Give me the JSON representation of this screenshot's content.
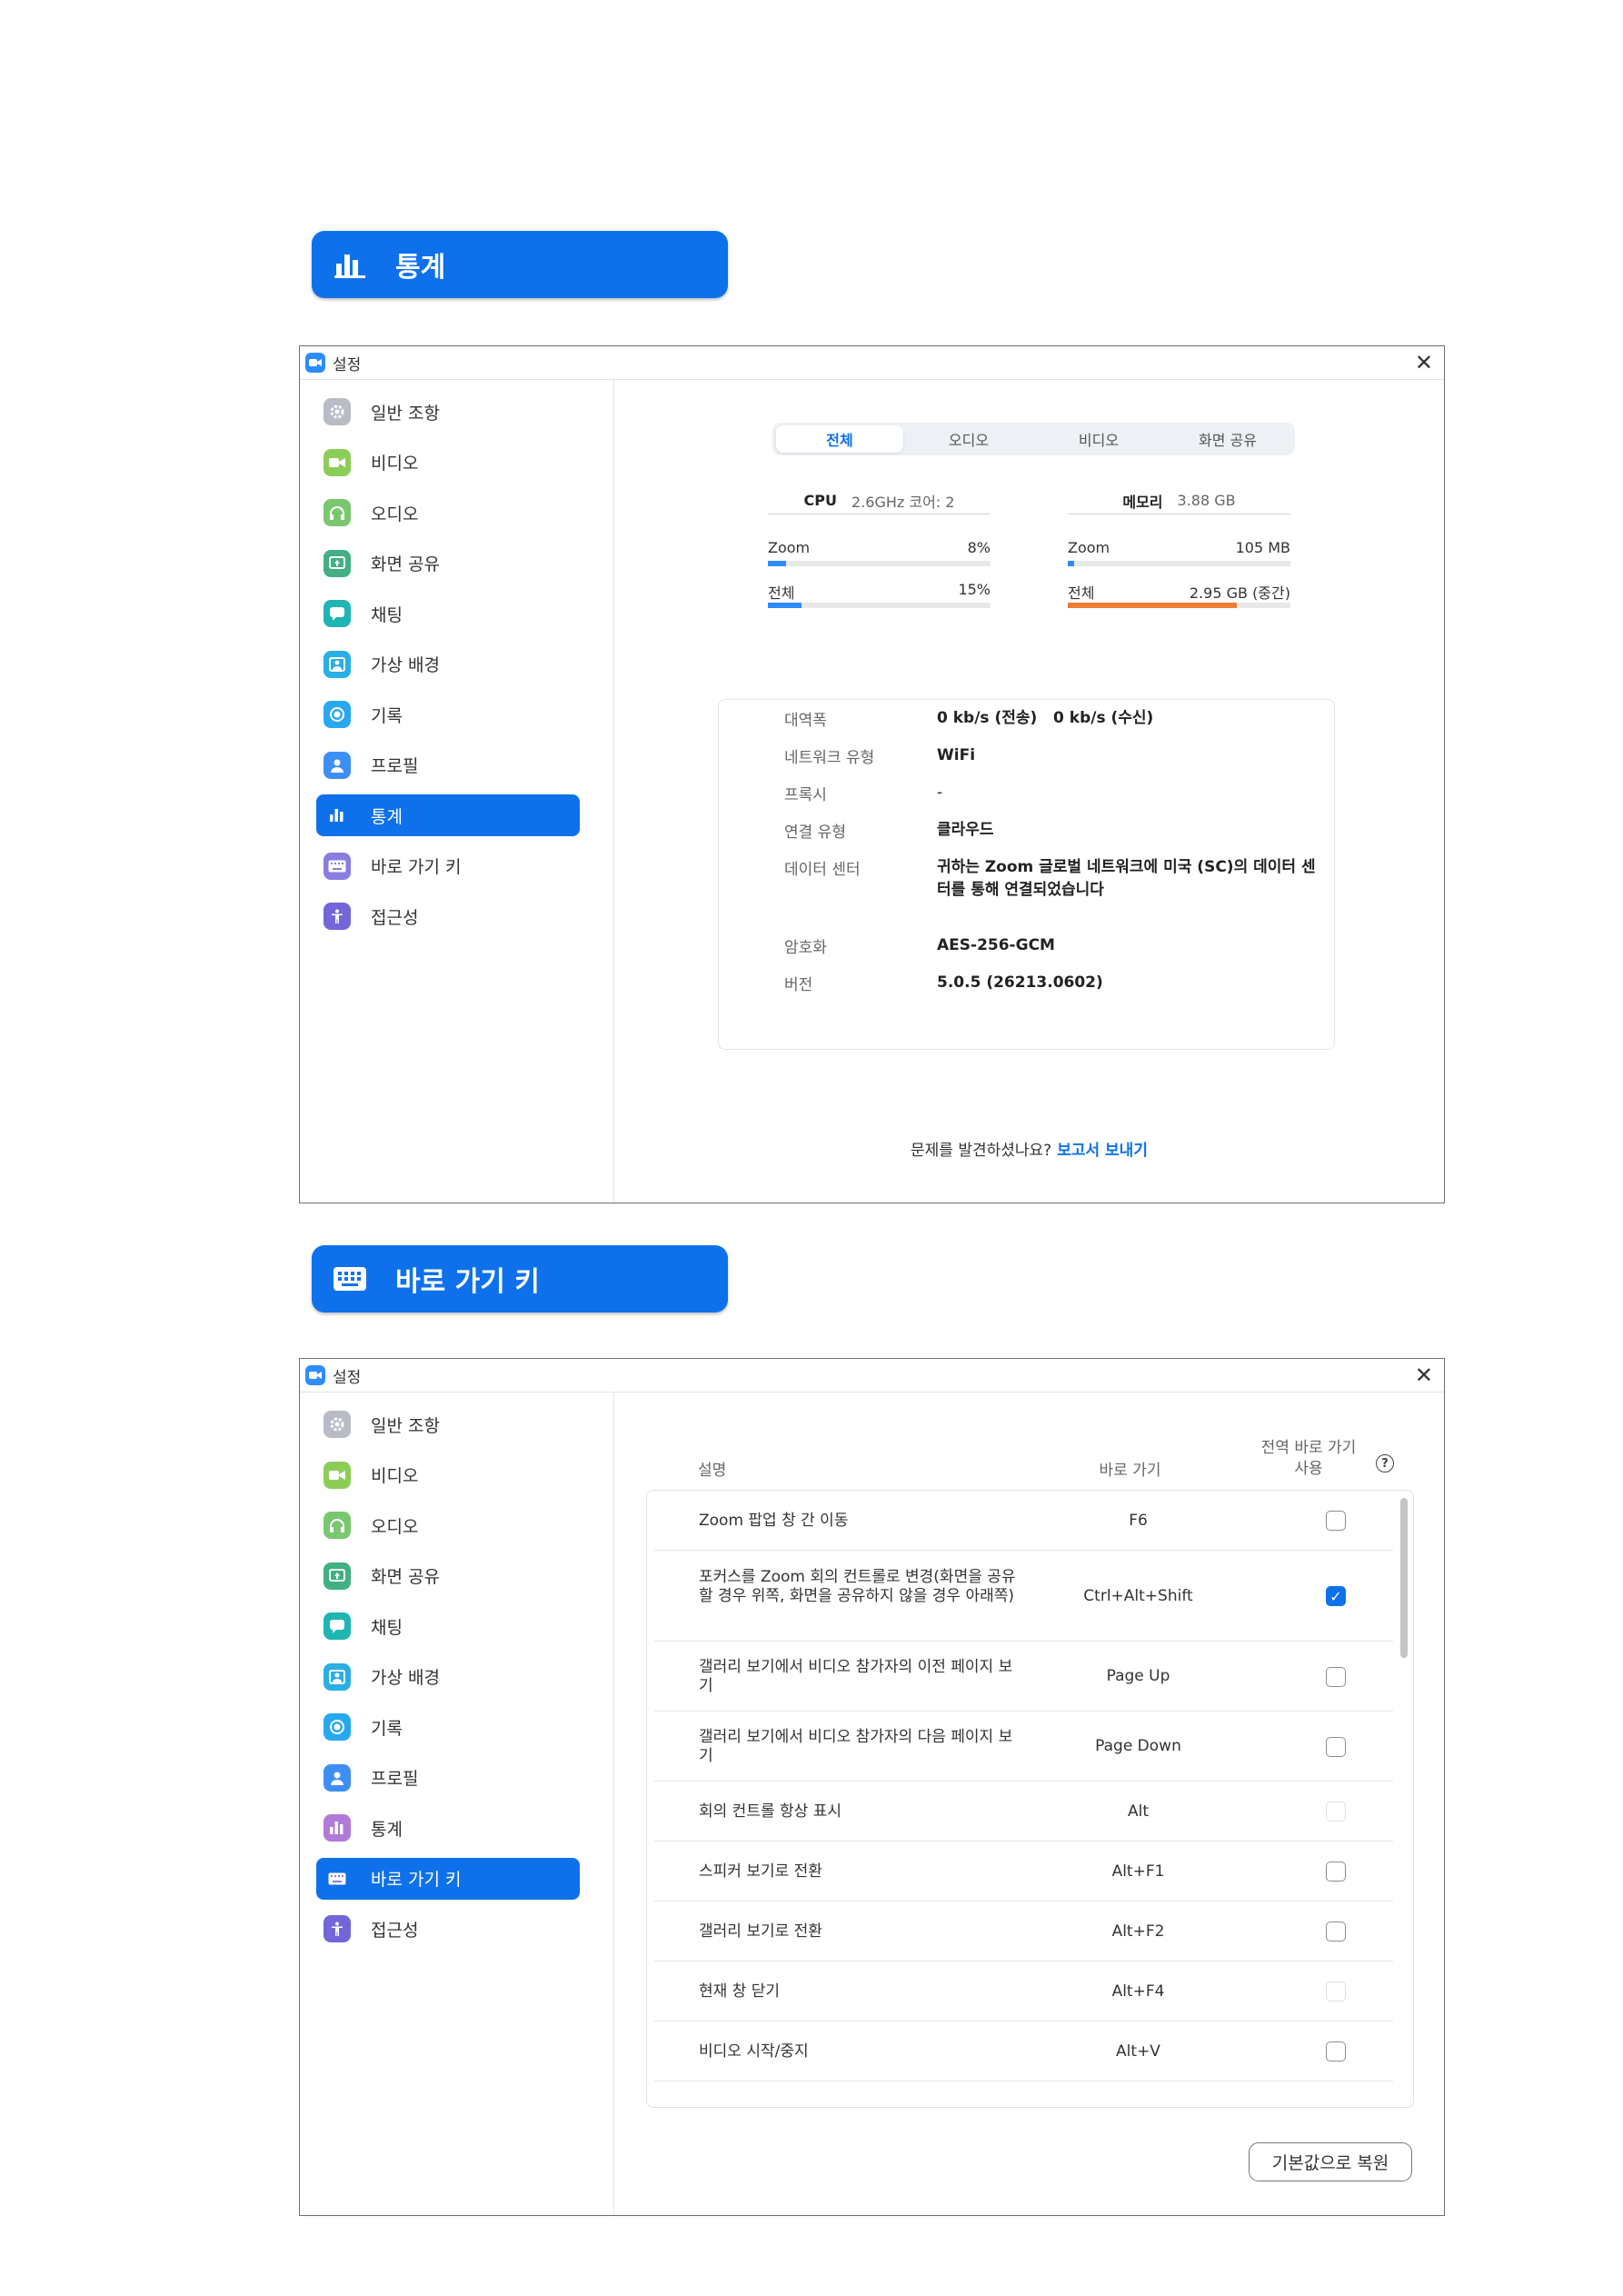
{
  "banner_stats": {
    "title": "통계",
    "icon": "bar-chart-icon"
  },
  "banner_shortcuts": {
    "title": "바로 가기 키",
    "icon": "keyboard-icon"
  },
  "window": {
    "title": "설정",
    "close": "✕"
  },
  "sidebar": {
    "items": [
      {
        "label": "일반 조항",
        "icon": "gear-icon",
        "color": "#b9bcc4"
      },
      {
        "label": "비디오",
        "icon": "video-camera-icon",
        "color": "#8ccd57"
      },
      {
        "label": "오디오",
        "icon": "headphones-icon",
        "color": "#79c86f"
      },
      {
        "label": "화면 공유",
        "icon": "share-screen-icon",
        "color": "#41b083"
      },
      {
        "label": "채팅",
        "icon": "chat-bubble-icon",
        "color": "#1fb5b2"
      },
      {
        "label": "가상 배경",
        "icon": "person-background-icon",
        "color": "#2aaee6"
      },
      {
        "label": "기록",
        "icon": "record-icon",
        "color": "#28a8f0"
      },
      {
        "label": "프로필",
        "icon": "profile-icon",
        "color": "#3d8ff5"
      },
      {
        "label": "통계",
        "icon": "bar-chart-icon",
        "color": "#b27ad8"
      },
      {
        "label": "바로 가기 키",
        "icon": "keyboard-icon",
        "color": "#8a7de0"
      },
      {
        "label": "접근성",
        "icon": "accessibility-icon",
        "color": "#7366d9"
      }
    ]
  },
  "stats": {
    "tabs": [
      "전체",
      "오디오",
      "비디오",
      "화면 공유"
    ],
    "cpu": {
      "label": "CPU",
      "detail": "2.6GHz 코어: 2",
      "rows": [
        {
          "name": "Zoom",
          "value": "8%",
          "fill": 0.08,
          "color": "#2d8cff"
        },
        {
          "name": "전체",
          "value": "15%",
          "fill": 0.15,
          "color": "#2d8cff"
        }
      ]
    },
    "memory": {
      "label": "메모리",
      "detail": "3.88 GB",
      "rows": [
        {
          "name": "Zoom",
          "value": "105 MB",
          "fill": 0.03,
          "color": "#2d8cff"
        },
        {
          "name": "전체",
          "value": "2.95 GB (중간)",
          "fill": 0.76,
          "color": "#ed7d31"
        }
      ]
    },
    "info": [
      {
        "label": "대역폭",
        "value": "0 kb/s (전송)   0 kb/s (수신)"
      },
      {
        "label": "네트워크 유형",
        "value": "WiFi"
      },
      {
        "label": "프록시",
        "value": "-"
      },
      {
        "label": "연결 유형",
        "value": "클라우드"
      },
      {
        "label": "데이터 센터",
        "value": "귀하는 Zoom 글로벌 네트워크에 미국 (SC)의 데이터 센터를 통해 연결되었습니다"
      },
      {
        "label": "암호화",
        "value": "AES-256-GCM"
      },
      {
        "label": "버전",
        "value": "5.0.5 (26213.0602)"
      }
    ],
    "footer_text": "문제를 발견하셨나요?",
    "footer_link": "보고서 보내기"
  },
  "shortcuts": {
    "col_desc": "설명",
    "col_key": "바로 가기",
    "col_global_1": "전역 바로 가기",
    "col_global_2": "사용",
    "help": "?",
    "rows": [
      {
        "desc": "Zoom 팝업 창 간 이동",
        "key": "F6",
        "state": "unchecked"
      },
      {
        "desc": "포커스를 Zoom 회의 컨트롤로 변경(화면을 공유할 경우 위쪽, 화면을 공유하지 않을 경우 아래쪽)",
        "key": "Ctrl+Alt+Shift",
        "state": "checked"
      },
      {
        "desc": "갤러리 보기에서 비디오 참가자의 이전 페이지 보기",
        "key": "Page Up",
        "state": "unchecked"
      },
      {
        "desc": "갤러리 보기에서 비디오 참가자의 다음 페이지 보기",
        "key": "Page Down",
        "state": "unchecked"
      },
      {
        "desc": "회의 컨트롤 항상 표시",
        "key": "Alt",
        "state": "disabled"
      },
      {
        "desc": "스피커 보기로 전환",
        "key": "Alt+F1",
        "state": "unchecked"
      },
      {
        "desc": "갤러리 보기로 전환",
        "key": "Alt+F2",
        "state": "unchecked"
      },
      {
        "desc": "현재 창 닫기",
        "key": "Alt+F4",
        "state": "disabled"
      },
      {
        "desc": "비디오 시작/중지",
        "key": "Alt+V",
        "state": "unchecked"
      }
    ],
    "reset_button": "기본값으로 복원"
  }
}
